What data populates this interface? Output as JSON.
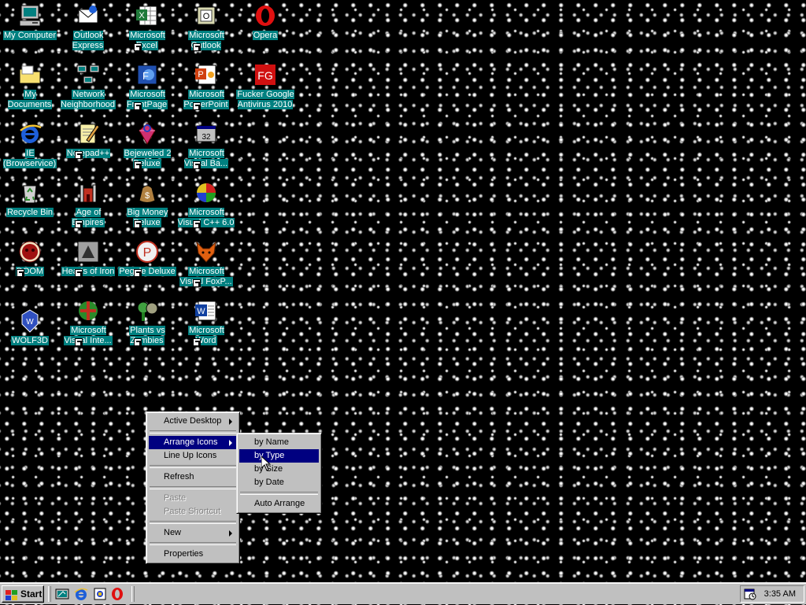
{
  "desktop_icons": [
    {
      "label": "My Computer",
      "icon": "my-computer-icon"
    },
    {
      "label": "My Documents",
      "icon": "folder-icon"
    },
    {
      "label": "IE (Browservice)",
      "icon": "ie-icon"
    },
    {
      "label": "Recycle Bin",
      "icon": "recycle-bin-icon"
    },
    {
      "label": "DOOM",
      "icon": "doom-icon"
    },
    {
      "label": "WOLF3D",
      "icon": "wolf3d-icon"
    },
    {
      "label": "Outlook Express",
      "icon": "outlook-express-icon"
    },
    {
      "label": "Network Neighborhood",
      "icon": "network-icon"
    },
    {
      "label": "Notepad++",
      "icon": "notepad-icon"
    },
    {
      "label": "Age of Empires",
      "icon": "age-of-empires-icon"
    },
    {
      "label": "Hearts of Iron",
      "icon": "hearts-of-iron-icon"
    },
    {
      "label": "Microsoft Visual Inte...",
      "icon": "visual-interdev-icon"
    },
    {
      "label": "Microsoft Excel",
      "icon": "excel-icon"
    },
    {
      "label": "Microsoft FrontPage",
      "icon": "frontpage-icon"
    },
    {
      "label": "Bejeweled 2 Deluxe",
      "icon": "bejeweled-icon"
    },
    {
      "label": "Big Money Deluxe",
      "icon": "big-money-icon"
    },
    {
      "label": "Peggle Deluxe",
      "icon": "peggle-icon"
    },
    {
      "label": "Plants vs Zombies",
      "icon": "plants-vs-zombies-icon"
    },
    {
      "label": "Microsoft Outlook",
      "icon": "outlook-icon"
    },
    {
      "label": "Microsoft PowerPoint",
      "icon": "powerpoint-icon"
    },
    {
      "label": "Microsoft Visual Ba...",
      "icon": "visual-basic-icon"
    },
    {
      "label": "Microsoft Visual C++ 6.0",
      "icon": "visual-cpp-icon"
    },
    {
      "label": "Microsoft Visual FoxP...",
      "icon": "visual-foxpro-icon"
    },
    {
      "label": "Microsoft Word",
      "icon": "word-icon"
    },
    {
      "label": "Opera",
      "icon": "opera-icon"
    },
    {
      "label": "Fucker Google Antivirus 2010",
      "icon": "antivirus-icon"
    }
  ],
  "context_menu": {
    "items": [
      {
        "label": "Active Desktop",
        "submenu": true
      },
      {
        "label": "Arrange Icons",
        "submenu": true,
        "highlighted": true
      },
      {
        "label": "Line Up Icons"
      },
      {
        "label": "Refresh"
      },
      {
        "label": "Paste",
        "disabled": true
      },
      {
        "label": "Paste Shortcut",
        "disabled": true
      },
      {
        "label": "New",
        "submenu": true
      },
      {
        "label": "Properties"
      }
    ]
  },
  "arrange_submenu": {
    "items": [
      {
        "label": "by Name"
      },
      {
        "label": "by Type",
        "highlighted": true
      },
      {
        "label": "by Size"
      },
      {
        "label": "by Date"
      },
      {
        "label": "Auto Arrange"
      }
    ]
  },
  "taskbar": {
    "start_label": "Start",
    "quick_launch": [
      "show-desktop-icon",
      "ie-icon",
      "channels-icon",
      "opera-icon"
    ],
    "clock": "3:35 AM"
  },
  "colors": {
    "desktop_label_bg": "#008080",
    "menu_highlight": "#000080",
    "taskbar": "#c0c0c0"
  }
}
